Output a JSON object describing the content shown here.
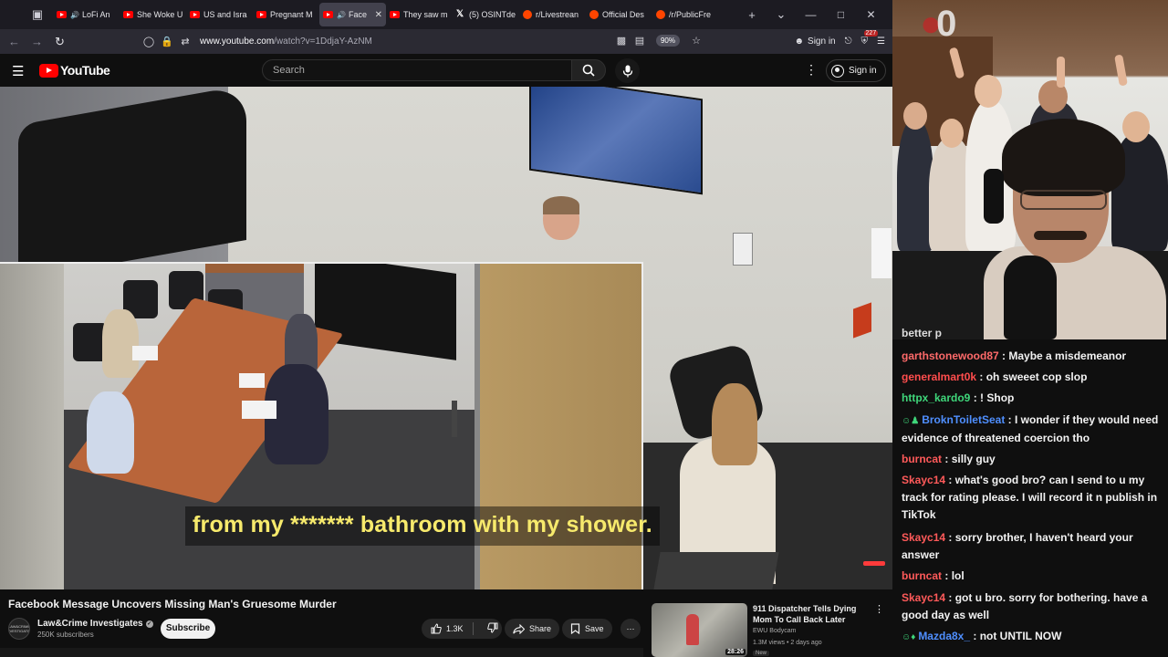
{
  "browser": {
    "tabs": [
      {
        "title": "LoFi An",
        "type": "youtube",
        "audio": true,
        "active": false
      },
      {
        "title": "She Woke U",
        "type": "youtube",
        "audio": false,
        "active": false
      },
      {
        "title": "US and Isra",
        "type": "youtube",
        "audio": false,
        "active": false
      },
      {
        "title": "Pregnant M",
        "type": "youtube",
        "audio": false,
        "active": false
      },
      {
        "title": "Face",
        "type": "youtube",
        "audio": true,
        "active": true
      },
      {
        "title": "They saw m",
        "type": "youtube",
        "audio": false,
        "active": false
      },
      {
        "title": "(5) OSINTde",
        "type": "x",
        "audio": false,
        "active": false
      },
      {
        "title": "r/Livestrean",
        "type": "reddit",
        "audio": false,
        "active": false
      },
      {
        "title": "Official Des",
        "type": "reddit",
        "audio": false,
        "active": false
      },
      {
        "title": "/r/PublicFre",
        "type": "reddit",
        "audio": false,
        "active": false
      }
    ],
    "url_host": "www.youtube.com",
    "url_path": "/watch?v=1DdjaY-AzNM",
    "zoom": "90%",
    "sign_in": "Sign in",
    "notification_count": "227"
  },
  "youtube": {
    "logo_text": "YouTube",
    "search_placeholder": "Search",
    "sign_in": "Sign in"
  },
  "video": {
    "subtitle": "from my ******* bathroom with my shower.",
    "title": "Facebook Message Uncovers Missing Man's Gruesome Murder",
    "channel_name": "Law&Crime Investigates",
    "channel_avatar_text": "LAW&CRIME INVESTIGATES",
    "subscribers": "250K subscribers",
    "subscribe_label": "Subscribe",
    "likes": "1.3K",
    "share_label": "Share",
    "save_label": "Save"
  },
  "recommended": {
    "title": "911 Dispatcher Tells Dying Mom To Call Back Later",
    "channel": "EWU Bodycam",
    "meta": "1.3M views • 2 days ago",
    "badge": "New",
    "duration": "28:26"
  },
  "stream_overlay": {
    "logo_text": "0"
  },
  "chat": {
    "partial": "better p",
    "messages": [
      {
        "user": "garthstonewood87",
        "color": "#ff6a6a",
        "text": "Maybe a misdemeanor",
        "badge": ""
      },
      {
        "user": "generalmart0k",
        "color": "#ff4d4d",
        "text": "oh sweeet cop slop",
        "badge": ""
      },
      {
        "user": "httpx_kardo9",
        "color": "#3fd67a",
        "text": "! Shop",
        "badge": ""
      },
      {
        "user": "BroknToiletSeat",
        "color": "#4f8fff",
        "text": "I wonder if they would need evidence of threatened coercion tho",
        "badge": "☺♟"
      },
      {
        "user": "burncat",
        "color": "#ff5a5a",
        "text": "silly guy",
        "badge": ""
      },
      {
        "user": "Skayc14",
        "color": "#ff5a5a",
        "text": "what's good bro? can I send to u my track for rating please. I will record it n publish in TikTok",
        "badge": ""
      },
      {
        "user": "Skayc14",
        "color": "#ff5a5a",
        "text": "sorry brother, I haven't heard your answer",
        "badge": ""
      },
      {
        "user": "burncat",
        "color": "#ff5a5a",
        "text": "lol",
        "badge": ""
      },
      {
        "user": "Skayc14",
        "color": "#ff5a5a",
        "text": "got u bro. sorry for bothering. have a good day as well",
        "badge": ""
      },
      {
        "user": "Mazda8x_",
        "color": "#4f8fff",
        "text": "not UNTIL NOW",
        "badge": "☺♦"
      }
    ]
  }
}
